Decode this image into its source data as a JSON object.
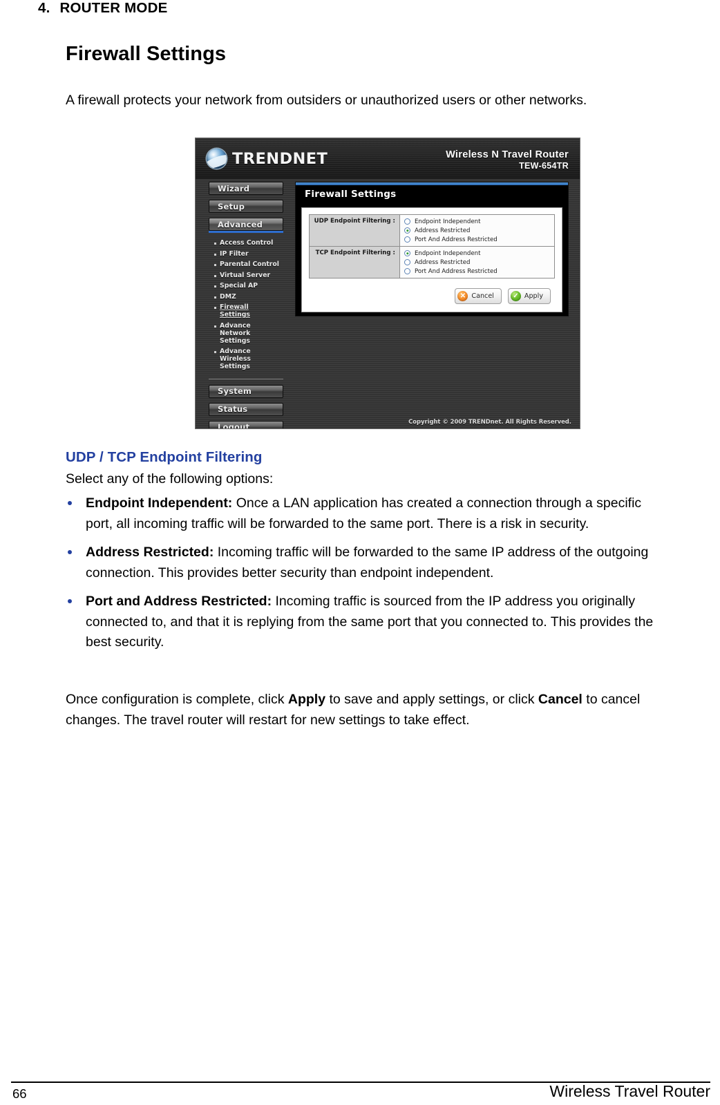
{
  "document": {
    "section_number": "4.",
    "section_title": "ROUTER MODE",
    "page_title": "Firewall Settings",
    "intro_paragraph": "A firewall protects your network from outsiders or unauthorized users or other networks.",
    "subsection_heading": "UDP / TCP Endpoint Filtering",
    "select_options_line": "Select any of the following options:",
    "closing_paragraph_prefix": "Once configuration is complete, click ",
    "closing_apply": "Apply",
    "closing_paragraph_mid": " to save and apply settings, or click ",
    "closing_cancel": "Cancel",
    "closing_paragraph_suffix": " to cancel changes. The travel router will restart for new settings to take effect."
  },
  "bullets": [
    {
      "term": "Endpoint Independent:",
      "text": " Once a LAN application has created a connection through a specific port, all incoming traffic will be forwarded to the same port. There is a risk in security."
    },
    {
      "term": "Address Restricted:",
      "text": " Incoming traffic will be forwarded to the same IP address of the outgoing connection. This provides better security than endpoint independent."
    },
    {
      "term": "Port and Address Restricted:",
      "text": " Incoming traffic is sourced from the IP address you originally connected to, and that it is replying from the same port that you connected to. This provides the best security."
    }
  ],
  "router_ui": {
    "brand": "TRENDNET",
    "product_name": "Wireless N Travel Router",
    "model_number": "TEW-654TR",
    "panel_title": "Firewall Settings",
    "copyright": "Copyright © 2009 TRENDnet. All Rights Reserved.",
    "nav_buttons": [
      {
        "label": "Wizard",
        "active": false
      },
      {
        "label": "Setup",
        "active": false
      },
      {
        "label": "Advanced",
        "active": true
      }
    ],
    "nav_buttons_bottom": [
      {
        "label": "System"
      },
      {
        "label": "Status"
      },
      {
        "label": "Logout"
      }
    ],
    "submenu": [
      {
        "label": "Access Control",
        "current": false
      },
      {
        "label": "IP Filter",
        "current": false
      },
      {
        "label": "Parental Control",
        "current": false
      },
      {
        "label": "Virtual Server",
        "current": false
      },
      {
        "label": "Special AP",
        "current": false
      },
      {
        "label": "DMZ",
        "current": false
      },
      {
        "label": "Firewall Settings",
        "current": true
      },
      {
        "label": "Advance Network Settings",
        "current": false
      },
      {
        "label": "Advance Wireless Settings",
        "current": false
      }
    ],
    "filter_rows": [
      {
        "label": "UDP Endpoint Filtering :",
        "options": [
          {
            "label": "Endpoint Independent",
            "selected": false
          },
          {
            "label": "Address Restricted",
            "selected": true
          },
          {
            "label": "Port And Address Restricted",
            "selected": false
          }
        ]
      },
      {
        "label": "TCP Endpoint Filtering :",
        "options": [
          {
            "label": "Endpoint Independent",
            "selected": true
          },
          {
            "label": "Address Restricted",
            "selected": false
          },
          {
            "label": "Port And Address Restricted",
            "selected": false
          }
        ]
      }
    ],
    "buttons": {
      "cancel_label": "Cancel",
      "apply_label": "Apply",
      "cancel_icon": "x-circle-icon",
      "apply_icon": "check-circle-icon"
    },
    "accent_color": "#2d6cb5"
  },
  "footer": {
    "page_number": "66",
    "doc_title": "Wireless Travel Router"
  }
}
